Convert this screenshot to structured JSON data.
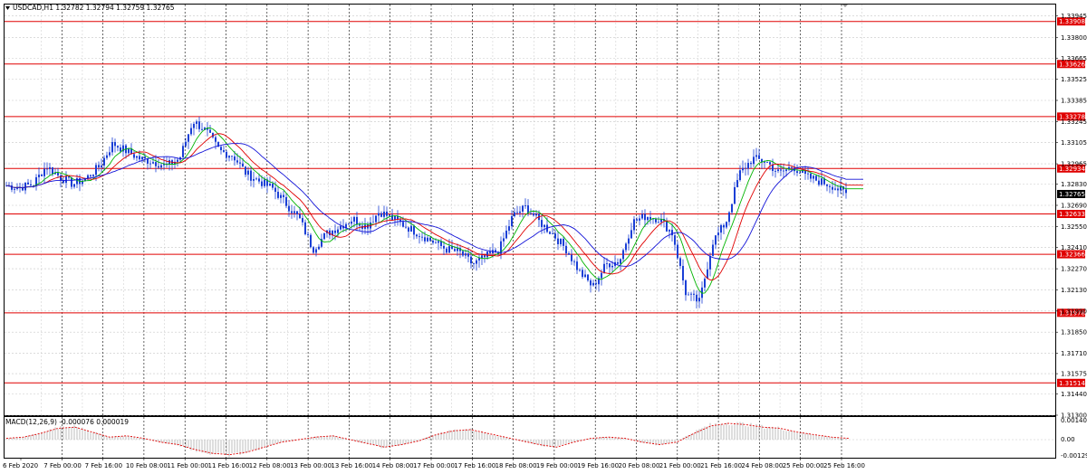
{
  "header": {
    "symbol_label": "USDCAD,H1  1.32782 1.32794 1.32759 1.32765"
  },
  "indicator": {
    "macd_label": "MACD(12,26,9) -0.000076 0.000019",
    "axis_labels": [
      "0.001401",
      "0.00",
      "-0.001292"
    ]
  },
  "colors": {
    "background": "#ffffff",
    "grid": "#c8c8c8",
    "vgrid": "#000000",
    "candle": "#1a3fd6",
    "ma_fast": "#00b400",
    "ma_mid": "#e00000",
    "ma_slow": "#1414d8",
    "level": "#e00000",
    "current_price_bg": "#000000",
    "macd_hist": "#a0a0a0",
    "macd_signal": "#e00000"
  },
  "chart_data": {
    "type": "line",
    "title": "USDCAD,H1  1.32782 1.32794 1.32759 1.32765",
    "xlabel": "",
    "ylabel": "",
    "ylim": [
      1.313,
      1.3402
    ],
    "grid": true,
    "y_ticks": [
      "1.33945",
      "1.33800",
      "1.33665",
      "1.33525",
      "1.33385",
      "1.33245",
      "1.33105",
      "1.32965",
      "1.32830",
      "1.32690",
      "1.32550",
      "1.32410",
      "1.32270",
      "1.32130",
      "1.31990",
      "1.31850",
      "1.31710",
      "1.31575",
      "1.31440",
      "1.31300"
    ],
    "x_ticks": [
      "6 Feb 2020",
      "7 Feb 00:00",
      "7 Feb 16:00",
      "10 Feb 08:00",
      "11 Feb 00:00",
      "11 Feb 16:00",
      "12 Feb 08:00",
      "13 Feb 00:00",
      "13 Feb 16:00",
      "14 Feb 08:00",
      "17 Feb 00:00",
      "17 Feb 16:00",
      "18 Feb 08:00",
      "19 Feb 00:00",
      "19 Feb 16:00",
      "20 Feb 08:00",
      "21 Feb 00:00",
      "21 Feb 16:00",
      "24 Feb 08:00",
      "25 Feb 00:00",
      "25 Feb 16:00"
    ],
    "levels": [
      "1.33908",
      "1.33626",
      "1.33278",
      "1.32934",
      "1.32633",
      "1.32366",
      "1.31978",
      "1.31514"
    ],
    "current_price": "1.32765",
    "series": [
      {
        "values": [
          1.3282,
          1.3281,
          1.3283,
          1.3295,
          1.3288,
          1.3283,
          1.3287,
          1.3295,
          1.331,
          1.3305,
          1.33,
          1.3298,
          1.3295,
          1.33,
          1.3325,
          1.3318,
          1.3305,
          1.3302,
          1.329,
          1.3285,
          1.328,
          1.327,
          1.326,
          1.324,
          1.325,
          1.3255,
          1.326,
          1.3255,
          1.3265,
          1.326,
          1.3255,
          1.325,
          1.3245,
          1.324,
          1.3238,
          1.323,
          1.3235,
          1.324,
          1.3262,
          1.3268,
          1.3258,
          1.325,
          1.324,
          1.3225,
          1.3215,
          1.323,
          1.3232,
          1.3258,
          1.3262,
          1.326,
          1.325,
          1.321,
          1.3205,
          1.3245,
          1.3258,
          1.329,
          1.33,
          1.3298,
          1.329,
          1.3295,
          1.3288,
          1.3285,
          1.3282,
          1.32765
        ]
      }
    ],
    "macd": {
      "signal": [
        0.0001,
        0.0002,
        0.0005,
        0.0009,
        0.001,
        0.0006,
        0.0002,
        0.0003,
        0.0001,
        -0.0002,
        -0.0004,
        -0.0008,
        -0.0011,
        -0.0012,
        -0.001,
        -0.0006,
        -0.0002,
        0.0,
        0.0002,
        0.0003,
        0.0,
        -0.0003,
        -0.0006,
        -0.0004,
        -0.0001,
        0.0004,
        0.0007,
        0.0008,
        0.0005,
        0.0002,
        -0.0001,
        -0.0004,
        -0.0006,
        -0.0002,
        0.0001,
        0.0002,
        0.0001,
        -0.0002,
        -0.0004,
        -0.0002,
        0.0005,
        0.0011,
        0.0013,
        0.0012,
        0.001,
        0.0009,
        0.0006,
        0.0004,
        0.0002,
        0.0001
      ]
    }
  }
}
